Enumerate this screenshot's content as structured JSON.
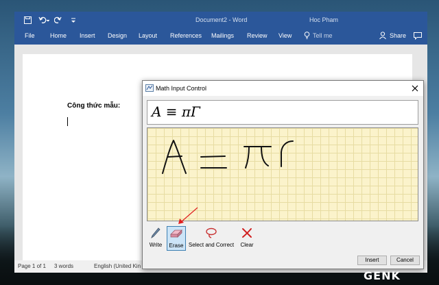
{
  "window": {
    "title": "Document2 - Word",
    "user": "Hoc Pham"
  },
  "ribbon": {
    "tabs": [
      "File",
      "Home",
      "Insert",
      "Design",
      "Layout",
      "References",
      "Mailings",
      "Review",
      "View"
    ],
    "tell_me": "Tell me",
    "share": "Share"
  },
  "document": {
    "heading": "Công thức mẫu:"
  },
  "status": {
    "page": "Page 1 of 1",
    "words": "3 words",
    "language": "English (United Kin"
  },
  "dialog": {
    "title": "Math Input Control",
    "preview_formula": "A ≡ πΓ",
    "tools": [
      {
        "label": "Write",
        "icon": "pen-icon"
      },
      {
        "label": "Erase",
        "icon": "eraser-icon"
      },
      {
        "label": "Select and Correct",
        "icon": "lasso-icon"
      },
      {
        "label": "Clear",
        "icon": "clear-icon"
      }
    ],
    "insert_button": "Insert",
    "cancel_button": "Cancel"
  },
  "watermark": "GENK",
  "colors": {
    "word_blue": "#2b579a",
    "grid_paper": "#fbf3cb",
    "annotation_arrow": "#e02020"
  }
}
